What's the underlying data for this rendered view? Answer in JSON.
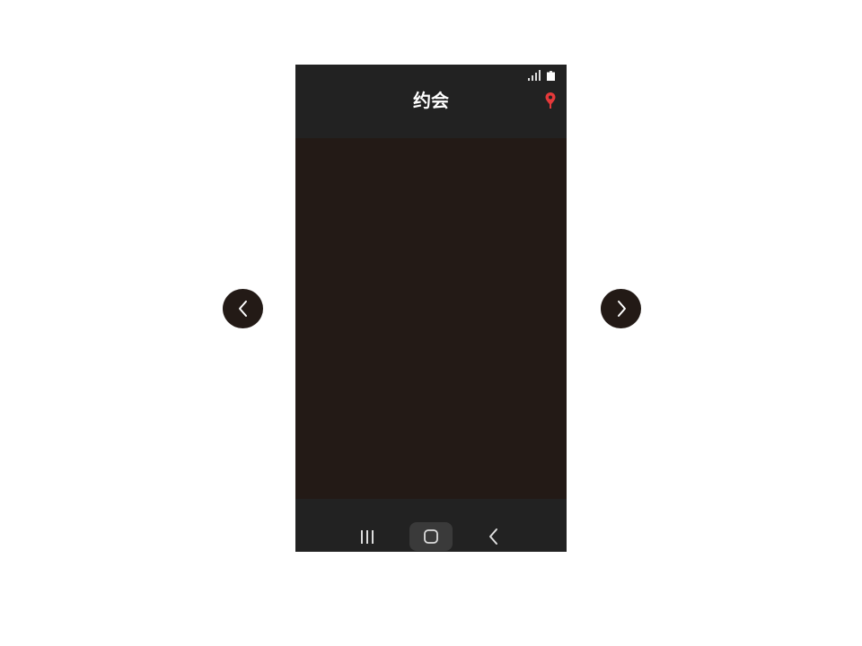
{
  "app": {
    "title": "约会"
  },
  "status_bar": {
    "icons": [
      "signal-icon",
      "battery-icon"
    ]
  },
  "header": {
    "action_icon": "location-pin-icon",
    "accent_color": "#e5393a"
  },
  "navigation": {
    "buttons": [
      "recents-icon",
      "home-icon",
      "back-icon"
    ]
  },
  "carousel": {
    "prev_icon": "chevron-left-icon",
    "next_icon": "chevron-right-icon"
  },
  "colors": {
    "phone_background": "#222222",
    "content_background": "#231a16",
    "arrow_button_background": "#231a16"
  }
}
